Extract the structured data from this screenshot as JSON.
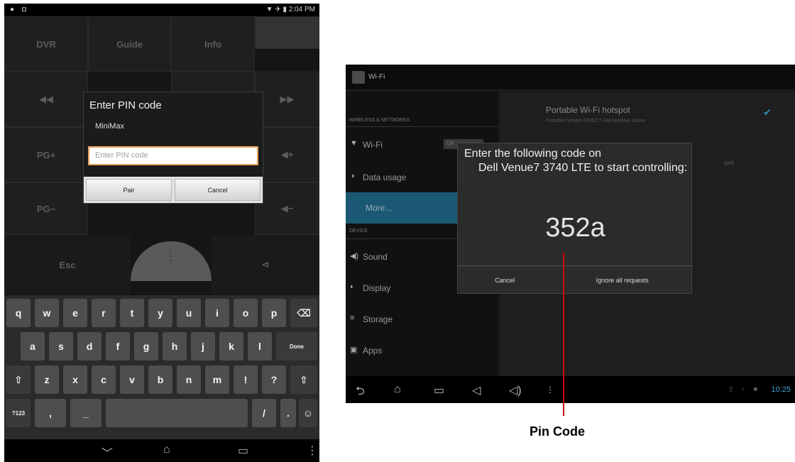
{
  "phone": {
    "status": {
      "left_icons": "● ◘",
      "right": "▼ ✈ ▮ 2:04 PM"
    },
    "remote": {
      "buttons": [
        "DVR",
        "Guide",
        "Info",
        "◀◀",
        "▶",
        "▶▶",
        "PG+",
        "◀+",
        "PG−",
        "◀−",
        "Esc",
        "⊲"
      ]
    },
    "dialog": {
      "title": "Enter PIN code",
      "device": "MiniMax",
      "input_placeholder": "Enter PIN code",
      "pair_label": "Pair",
      "cancel_label": "Cancel"
    },
    "keyboard": {
      "row1": [
        "q",
        "w",
        "e",
        "r",
        "t",
        "y",
        "u",
        "i",
        "o",
        "p",
        "⌫"
      ],
      "row2": [
        "a",
        "s",
        "d",
        "f",
        "g",
        "h",
        "j",
        "k",
        "l",
        "Done"
      ],
      "row3": [
        "⇧",
        "z",
        "x",
        "c",
        "v",
        "b",
        "n",
        "m",
        "!",
        "?",
        "⇧"
      ],
      "row4": [
        "?123",
        ",",
        "_",
        "",
        "/",
        ".",
        "☺"
      ]
    },
    "navbar": {
      "back": "﹀",
      "home": "⌂",
      "recent": "▭",
      "menu": "⋮"
    }
  },
  "tablet": {
    "title": "Wi-Fi",
    "sidebar": {
      "category_wireless": "WIRELESS & NETWORKS",
      "category_device": "DEVICE",
      "wifi_toggle": "ON",
      "items": [
        {
          "icon": "wifi-icon",
          "glyph": "▼",
          "label": "Wi-Fi"
        },
        {
          "icon": "data-usage-icon",
          "glyph": "◑",
          "label": "Data usage"
        },
        {
          "icon": "",
          "glyph": "",
          "label": "More..."
        },
        {
          "icon": "sound-icon",
          "glyph": "◀)",
          "label": "Sound"
        },
        {
          "icon": "display-icon",
          "glyph": "◐",
          "label": "Display"
        },
        {
          "icon": "storage-icon",
          "glyph": "≡",
          "label": "Storage"
        },
        {
          "icon": "apps-icon",
          "glyph": "▣",
          "label": "Apps"
        }
      ]
    },
    "pane": {
      "hotspot_title": "Portable Wi-Fi hotspot",
      "hotspot_sub": "Portable hotspot DIRECT-AM-MiniMax active",
      "fragment": "spot"
    },
    "dialog": {
      "line1": "Enter the following code on",
      "line2": "Dell Venue7 3740 LTE to start controlling:",
      "code": "352a",
      "cancel_label": "Cancel",
      "ignore_label": "Ignore all requests"
    },
    "navbar": {
      "clock": "10:25",
      "status_icons": "▯ ↑ ■"
    }
  },
  "callout": {
    "label": "Pin Code",
    "color": "#cc0000"
  }
}
